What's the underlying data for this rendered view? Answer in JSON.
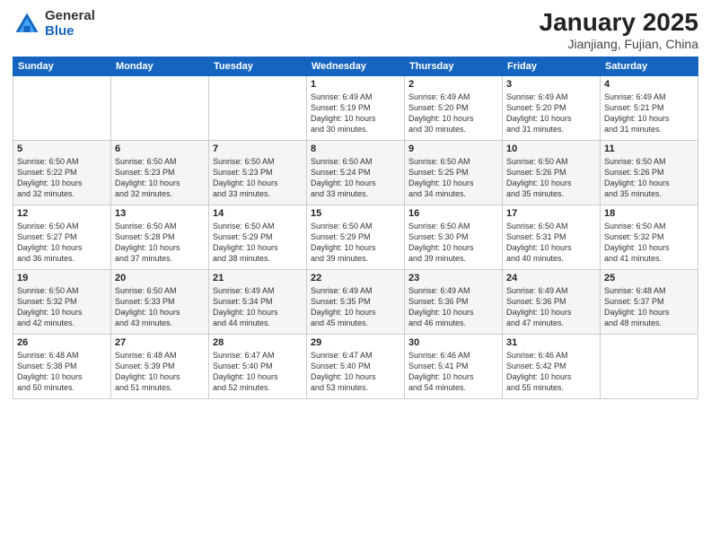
{
  "logo": {
    "general": "General",
    "blue": "Blue"
  },
  "title": {
    "month_year": "January 2025",
    "location": "Jianjiang, Fujian, China"
  },
  "weekdays": [
    "Sunday",
    "Monday",
    "Tuesday",
    "Wednesday",
    "Thursday",
    "Friday",
    "Saturday"
  ],
  "weeks": [
    [
      {
        "day": "",
        "info": ""
      },
      {
        "day": "",
        "info": ""
      },
      {
        "day": "",
        "info": ""
      },
      {
        "day": "1",
        "info": "Sunrise: 6:49 AM\nSunset: 5:19 PM\nDaylight: 10 hours\nand 30 minutes."
      },
      {
        "day": "2",
        "info": "Sunrise: 6:49 AM\nSunset: 5:20 PM\nDaylight: 10 hours\nand 30 minutes."
      },
      {
        "day": "3",
        "info": "Sunrise: 6:49 AM\nSunset: 5:20 PM\nDaylight: 10 hours\nand 31 minutes."
      },
      {
        "day": "4",
        "info": "Sunrise: 6:49 AM\nSunset: 5:21 PM\nDaylight: 10 hours\nand 31 minutes."
      }
    ],
    [
      {
        "day": "5",
        "info": "Sunrise: 6:50 AM\nSunset: 5:22 PM\nDaylight: 10 hours\nand 32 minutes."
      },
      {
        "day": "6",
        "info": "Sunrise: 6:50 AM\nSunset: 5:23 PM\nDaylight: 10 hours\nand 32 minutes."
      },
      {
        "day": "7",
        "info": "Sunrise: 6:50 AM\nSunset: 5:23 PM\nDaylight: 10 hours\nand 33 minutes."
      },
      {
        "day": "8",
        "info": "Sunrise: 6:50 AM\nSunset: 5:24 PM\nDaylight: 10 hours\nand 33 minutes."
      },
      {
        "day": "9",
        "info": "Sunrise: 6:50 AM\nSunset: 5:25 PM\nDaylight: 10 hours\nand 34 minutes."
      },
      {
        "day": "10",
        "info": "Sunrise: 6:50 AM\nSunset: 5:26 PM\nDaylight: 10 hours\nand 35 minutes."
      },
      {
        "day": "11",
        "info": "Sunrise: 6:50 AM\nSunset: 5:26 PM\nDaylight: 10 hours\nand 35 minutes."
      }
    ],
    [
      {
        "day": "12",
        "info": "Sunrise: 6:50 AM\nSunset: 5:27 PM\nDaylight: 10 hours\nand 36 minutes."
      },
      {
        "day": "13",
        "info": "Sunrise: 6:50 AM\nSunset: 5:28 PM\nDaylight: 10 hours\nand 37 minutes."
      },
      {
        "day": "14",
        "info": "Sunrise: 6:50 AM\nSunset: 5:29 PM\nDaylight: 10 hours\nand 38 minutes."
      },
      {
        "day": "15",
        "info": "Sunrise: 6:50 AM\nSunset: 5:29 PM\nDaylight: 10 hours\nand 39 minutes."
      },
      {
        "day": "16",
        "info": "Sunrise: 6:50 AM\nSunset: 5:30 PM\nDaylight: 10 hours\nand 39 minutes."
      },
      {
        "day": "17",
        "info": "Sunrise: 6:50 AM\nSunset: 5:31 PM\nDaylight: 10 hours\nand 40 minutes."
      },
      {
        "day": "18",
        "info": "Sunrise: 6:50 AM\nSunset: 5:32 PM\nDaylight: 10 hours\nand 41 minutes."
      }
    ],
    [
      {
        "day": "19",
        "info": "Sunrise: 6:50 AM\nSunset: 5:32 PM\nDaylight: 10 hours\nand 42 minutes."
      },
      {
        "day": "20",
        "info": "Sunrise: 6:50 AM\nSunset: 5:33 PM\nDaylight: 10 hours\nand 43 minutes."
      },
      {
        "day": "21",
        "info": "Sunrise: 6:49 AM\nSunset: 5:34 PM\nDaylight: 10 hours\nand 44 minutes."
      },
      {
        "day": "22",
        "info": "Sunrise: 6:49 AM\nSunset: 5:35 PM\nDaylight: 10 hours\nand 45 minutes."
      },
      {
        "day": "23",
        "info": "Sunrise: 6:49 AM\nSunset: 5:36 PM\nDaylight: 10 hours\nand 46 minutes."
      },
      {
        "day": "24",
        "info": "Sunrise: 6:49 AM\nSunset: 5:36 PM\nDaylight: 10 hours\nand 47 minutes."
      },
      {
        "day": "25",
        "info": "Sunrise: 6:48 AM\nSunset: 5:37 PM\nDaylight: 10 hours\nand 48 minutes."
      }
    ],
    [
      {
        "day": "26",
        "info": "Sunrise: 6:48 AM\nSunset: 5:38 PM\nDaylight: 10 hours\nand 50 minutes."
      },
      {
        "day": "27",
        "info": "Sunrise: 6:48 AM\nSunset: 5:39 PM\nDaylight: 10 hours\nand 51 minutes."
      },
      {
        "day": "28",
        "info": "Sunrise: 6:47 AM\nSunset: 5:40 PM\nDaylight: 10 hours\nand 52 minutes."
      },
      {
        "day": "29",
        "info": "Sunrise: 6:47 AM\nSunset: 5:40 PM\nDaylight: 10 hours\nand 53 minutes."
      },
      {
        "day": "30",
        "info": "Sunrise: 6:46 AM\nSunset: 5:41 PM\nDaylight: 10 hours\nand 54 minutes."
      },
      {
        "day": "31",
        "info": "Sunrise: 6:46 AM\nSunset: 5:42 PM\nDaylight: 10 hours\nand 55 minutes."
      },
      {
        "day": "",
        "info": ""
      }
    ]
  ],
  "row_shading": [
    "white",
    "shade",
    "white",
    "shade",
    "white"
  ]
}
